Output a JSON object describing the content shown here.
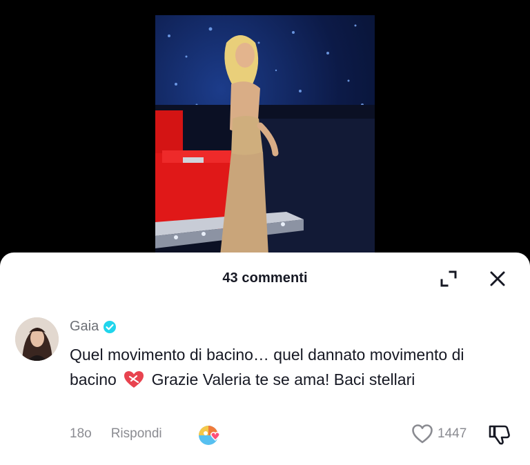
{
  "panel": {
    "title": "43 commenti"
  },
  "comment": {
    "author": "Gaia",
    "text_part1": "Quel movimento di bacino… quel dannato movimento di bacino",
    "text_part2": "Grazie Valeria te se ama! Baci stellari",
    "time": "18o",
    "reply_label": "Rispondi",
    "like_count": "1447"
  },
  "icons": {
    "expand": "expand-icon",
    "close": "close-icon",
    "verified": "verified-badge-icon",
    "heart_emoji": "mending-heart-emoji",
    "sticker": "gif-sticker-icon",
    "like": "heart-outline-icon",
    "dislike": "thumbs-down-icon"
  },
  "colors": {
    "text_primary": "#161823",
    "text_secondary": "#8a8b91",
    "verified": "#20d5ec"
  }
}
